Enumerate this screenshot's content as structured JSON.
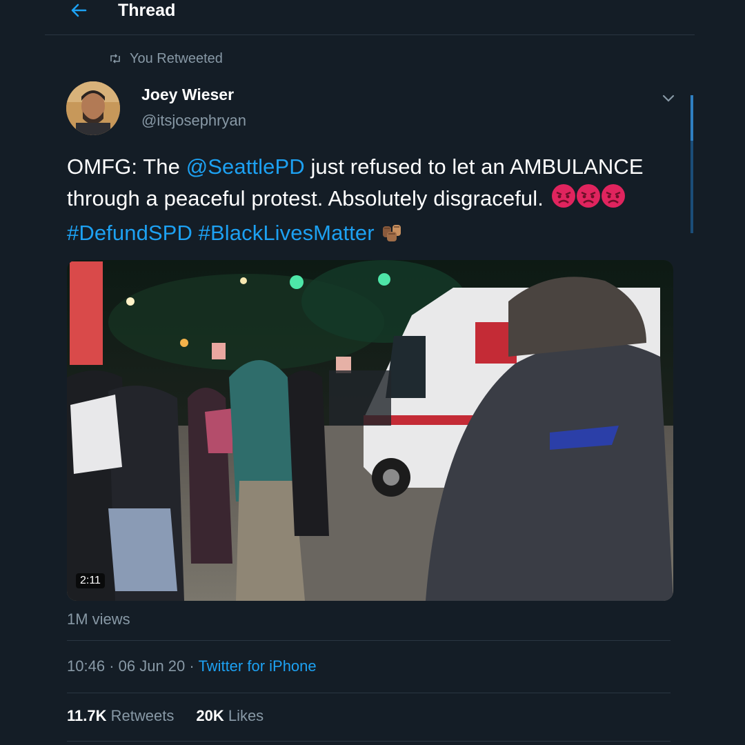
{
  "header": {
    "title": "Thread",
    "back_icon": "back-arrow-icon"
  },
  "social_context": {
    "text": "You Retweeted",
    "icon": "retweet-icon"
  },
  "author": {
    "name": "Joey Wieser",
    "handle": "@itsjosephryan"
  },
  "tweet": {
    "text_parts": {
      "part1": "OMFG: The ",
      "mention": "@SeattlePD",
      "part2": " just refused to let an AMBULANCE through a peaceful protest. Absolutely disgraceful. ",
      "hashtag1": "#DefundSPD",
      "hashtag2": "#BlackLivesMatter"
    },
    "emojis": [
      "angry-face-emoji",
      "angry-face-emoji",
      "angry-face-emoji",
      "raised-fists-emoji"
    ]
  },
  "media": {
    "duration": "2:11",
    "views": "1M views"
  },
  "meta": {
    "time": "10:46",
    "date": "06 Jun 20",
    "client": "Twitter for iPhone"
  },
  "stats": {
    "retweets_count": "11.7K",
    "retweets_label": "Retweets",
    "likes_count": "20K",
    "likes_label": "Likes"
  },
  "colors": {
    "background": "#141d26",
    "accent": "#1da1f2",
    "secondary_text": "#8899a6"
  }
}
